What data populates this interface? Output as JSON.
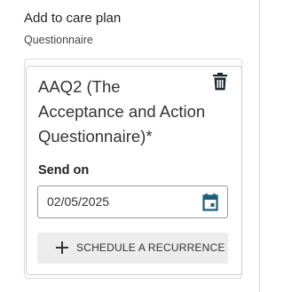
{
  "section": {
    "title": "Add to care plan",
    "subtitle": "Questionnaire"
  },
  "questionnaire": {
    "title": "AAQ2 (The Acceptance and Action Questionnaire)*",
    "delete_icon": "trash-icon",
    "send_on_label": "Send on",
    "send_on_value": "02/05/2025",
    "calendar_icon": "calendar-icon",
    "recurrence_button_label": "SCHEDULE A RECURRENCE",
    "recurrence_icon": "plus-icon"
  },
  "colors": {
    "accent": "#1f5d78",
    "button_bg": "#ececec",
    "border": "#cfcfcf"
  }
}
